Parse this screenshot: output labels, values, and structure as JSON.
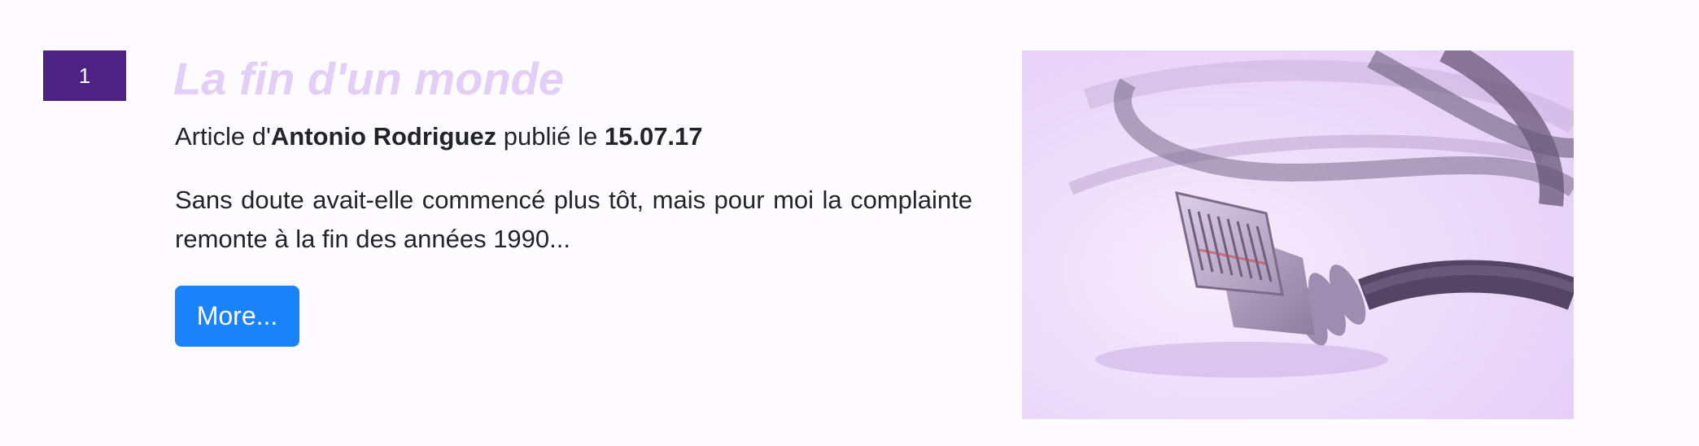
{
  "article": {
    "number": "1",
    "title": "La fin d'un monde",
    "byline": {
      "prefix": "Article d'",
      "author": "Antonio Rodriguez",
      "middle": " publié le ",
      "date": "15.07.17"
    },
    "excerpt": "Sans doute avait-elle commencé plus tôt, mais pour moi la complainte remonte à la fin des années 1990...",
    "more_label": "More...",
    "image": {
      "subject": "ethernet-cable-icon",
      "tint": "#e8d2fa"
    }
  },
  "colors": {
    "badge": "#4c2284",
    "title": "#e2cef6",
    "button": "#1a82fb",
    "background": "#fdfbfe"
  }
}
